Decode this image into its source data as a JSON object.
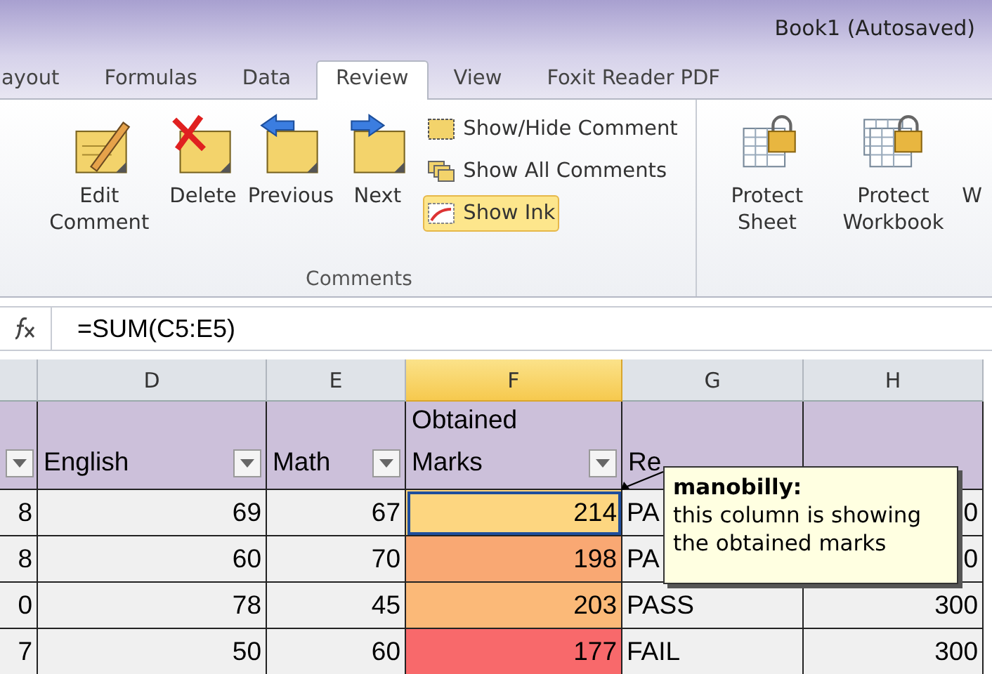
{
  "window": {
    "title": "Book1 (Autosaved)"
  },
  "tabs": [
    {
      "label": "ayout",
      "selected": false
    },
    {
      "label": "Formulas",
      "selected": false
    },
    {
      "label": "Data",
      "selected": false
    },
    {
      "label": "Review",
      "selected": true
    },
    {
      "label": "View",
      "selected": false
    },
    {
      "label": "Foxit Reader PDF",
      "selected": false
    }
  ],
  "ribbon": {
    "comments_group": {
      "label": "Comments",
      "large_buttons": [
        {
          "kind": "edit",
          "label": "Edit Comment"
        },
        {
          "kind": "delete",
          "label": "Delete"
        },
        {
          "kind": "previous",
          "label": "Previous"
        },
        {
          "kind": "next",
          "label": "Next"
        }
      ],
      "small_buttons": [
        {
          "kind": "showhide",
          "label": "Show/Hide Comment",
          "selected": false
        },
        {
          "kind": "showall",
          "label": "Show All Comments",
          "selected": false
        },
        {
          "kind": "ink",
          "label": "Show Ink",
          "selected": true
        }
      ]
    },
    "protect_buttons": [
      {
        "kind": "sheet",
        "label": "Protect Sheet"
      },
      {
        "kind": "workbook",
        "label": "Protect Workbook"
      },
      {
        "kind": "cut",
        "label": "W"
      }
    ]
  },
  "formula_bar": {
    "formula": "=SUM(C5:E5)"
  },
  "columns": [
    {
      "selected": false
    },
    {
      "letter": "D",
      "selected": false
    },
    {
      "letter": "E",
      "selected": false
    },
    {
      "letter": "F",
      "selected": true
    },
    {
      "letter": "G",
      "selected": false
    },
    {
      "letter": "H",
      "selected": false
    }
  ],
  "header_row": [
    {
      "filter": true
    },
    {
      "text": "English",
      "filter": true
    },
    {
      "text": "Math",
      "filter": true
    },
    {
      "text": "Obtained Marks",
      "filter": true
    },
    {
      "text": "Re",
      "filter": false
    },
    {
      "filter": false
    }
  ],
  "rows": [
    {
      "cells": [
        "8",
        "69",
        "67",
        "214",
        "PA",
        "0"
      ],
      "color": "#fdd680",
      "selected": true
    },
    {
      "cells": [
        "8",
        "60",
        "70",
        "198",
        "PA",
        "0"
      ],
      "color": "#f9a873",
      "selected": false
    },
    {
      "cells": [
        "0",
        "78",
        "45",
        "203",
        "PASS",
        "300"
      ],
      "color": "#fbb978",
      "selected": false
    },
    {
      "cells": [
        "7",
        "50",
        "60",
        "177",
        "FAIL",
        "300"
      ],
      "color": "#f8696b",
      "selected": false
    }
  ],
  "comment": {
    "author": "manobilly:",
    "text": "this column is showing the obtained marks"
  }
}
